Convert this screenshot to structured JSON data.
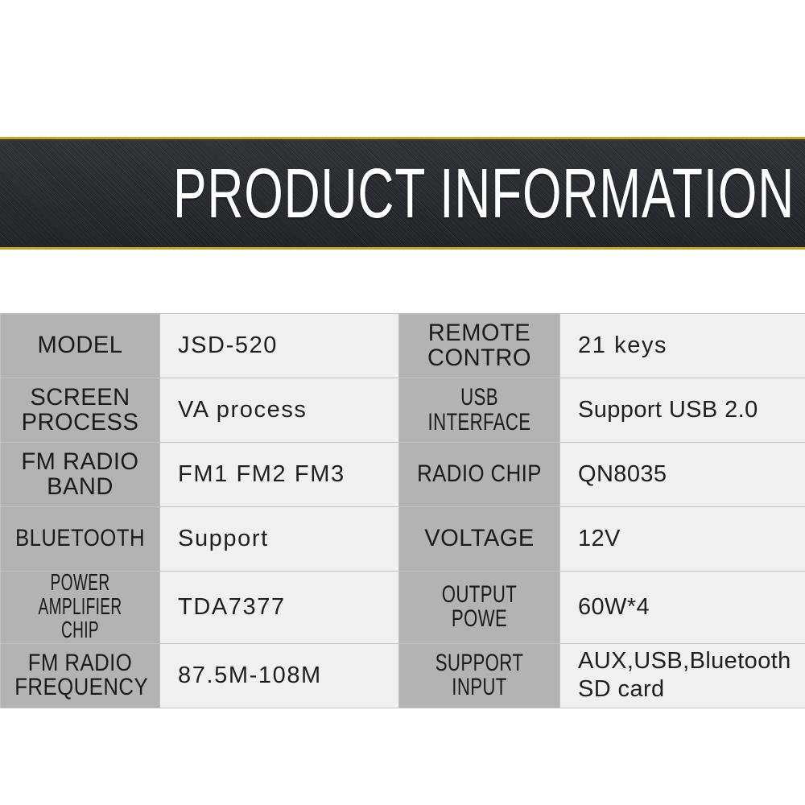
{
  "banner": {
    "title": "PRODUCT INFORMATION",
    "background_color": "#24282d",
    "accent_color": "#c9a227",
    "text_color": "#ffffff"
  },
  "table": {
    "label_bg": "#b3b3b3",
    "value_bg": "#f0f0f0",
    "border_color": "#c2c2c2",
    "rows": [
      {
        "left_label": "MODEL",
        "left_value": "JSD-520",
        "right_label": "REMOTE\nCONTRO",
        "right_value": "21 keys"
      },
      {
        "left_label": "SCREEN\nPROCESS",
        "left_value": "VA process",
        "right_label": "USB INTERFACE",
        "right_value": "Support USB 2.0"
      },
      {
        "left_label": "FM RADIO\nBAND",
        "left_value": "FM1 FM2 FM3",
        "right_label": "RADIO CHIP",
        "right_value": "QN8035"
      },
      {
        "left_label": "BLUETOOTH",
        "left_value": "Support",
        "right_label": "VOLTAGE",
        "right_value": "12V"
      },
      {
        "left_label": "POWER AMPLIFIER\nCHIP",
        "left_value": "TDA7377",
        "right_label": "OUTPUT POWE",
        "right_value": "60W*4"
      },
      {
        "left_label": "FM RADIO\nFREQUENCY",
        "left_value": "87.5M-108M",
        "right_label": "SUPPORT INPUT",
        "right_value": "AUX,USB,Bluetooth\nSD card"
      }
    ]
  }
}
